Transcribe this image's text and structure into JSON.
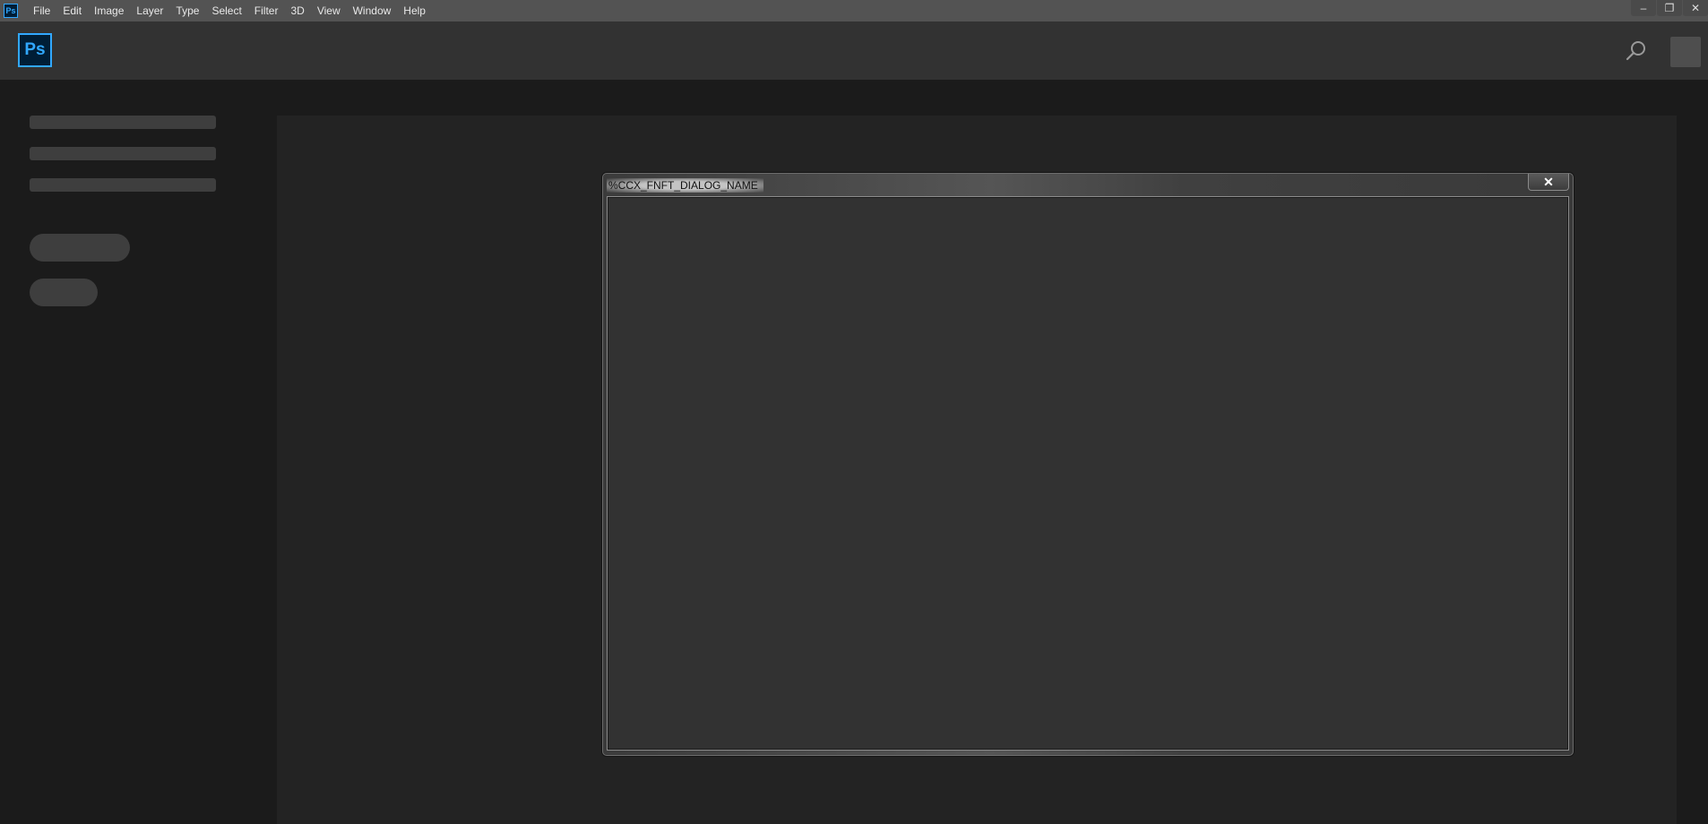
{
  "app": {
    "small_icon_text": "Ps",
    "logo_text": "Ps",
    "accent_color": "#31a8ff"
  },
  "menubar": {
    "items": [
      "File",
      "Edit",
      "Image",
      "Layer",
      "Type",
      "Select",
      "Filter",
      "3D",
      "View",
      "Window",
      "Help"
    ]
  },
  "window_controls": {
    "minimize": "–",
    "restore": "❐",
    "close": "✕"
  },
  "header": {
    "search_icon": "search-icon",
    "profile": "avatar"
  },
  "dialog": {
    "title": "%CCX_FNFT_DIALOG_NAME",
    "close_label": "✕"
  }
}
